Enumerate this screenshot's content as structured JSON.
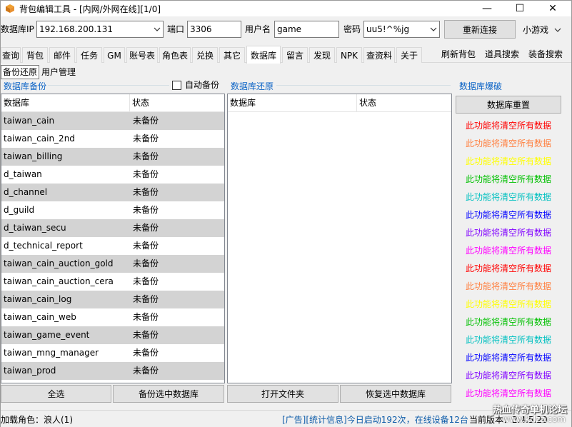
{
  "window": {
    "title": "背包编辑工具 - [内网/外网在线][1/0]",
    "minimize_glyph": "—",
    "maximize_glyph": "☐",
    "close_glyph": "✕"
  },
  "connection": {
    "db_ip_label": "数据库IP",
    "db_ip_value": "192.168.200.131",
    "port_label": "端口",
    "port_value": "3306",
    "user_label": "用户名",
    "user_value": "game",
    "password_label": "密码",
    "password_value": "uu5!^%jg",
    "reconnect_label": "重新连接",
    "minigame_label": "小游戏"
  },
  "tabs": [
    "查询",
    "背包",
    "邮件",
    "任务",
    "GM",
    "账号表",
    "角色表",
    "兑换",
    "其它",
    "数据库",
    "留言",
    "发现",
    "NPK",
    "查资料",
    "关于"
  ],
  "active_tab": "数据库",
  "toolbar": {
    "refresh_bag": "刷新背包",
    "item_search": "道具搜索",
    "equip_search": "装备搜索"
  },
  "subtabs": [
    "备份还原",
    "用户管理"
  ],
  "backup": {
    "section_title": "数据库备份",
    "auto_backup_label": "自动备份",
    "auto_backup_checked": false,
    "col_db": "数据库",
    "col_status": "状态",
    "rows": [
      {
        "db": "taiwan_cain",
        "status": "未备份"
      },
      {
        "db": "taiwan_cain_2nd",
        "status": "未备份"
      },
      {
        "db": "taiwan_billing",
        "status": "未备份"
      },
      {
        "db": "d_taiwan",
        "status": "未备份"
      },
      {
        "db": "d_channel",
        "status": "未备份"
      },
      {
        "db": "d_guild",
        "status": "未备份"
      },
      {
        "db": "d_taiwan_secu",
        "status": "未备份"
      },
      {
        "db": "d_technical_report",
        "status": "未备份"
      },
      {
        "db": "taiwan_cain_auction_gold",
        "status": "未备份"
      },
      {
        "db": "taiwan_cain_auction_cera",
        "status": "未备份"
      },
      {
        "db": "taiwan_cain_log",
        "status": "未备份"
      },
      {
        "db": "taiwan_cain_web",
        "status": "未备份"
      },
      {
        "db": "taiwan_game_event",
        "status": "未备份"
      },
      {
        "db": "taiwan_mng_manager",
        "status": "未备份"
      },
      {
        "db": "taiwan_prod",
        "status": "未备份"
      }
    ],
    "select_all_label": "全选",
    "backup_selected_label": "备份选中数据库"
  },
  "restore": {
    "section_title": "数据库还原",
    "col_db": "数据库",
    "col_status": "状态",
    "open_folder_label": "打开文件夹",
    "restore_selected_label": "恢复选中数据库"
  },
  "breach": {
    "section_title": "数据库爆破",
    "reset_label": "数据库重置",
    "warning_text": "此功能将清空所有数据",
    "warning_colors": [
      "#ff0000",
      "#ff8040",
      "#ffff00",
      "#00c000",
      "#00c0c0",
      "#0000ff",
      "#8000ff",
      "#ff00ff",
      "#ff0000",
      "#ff8040",
      "#ffff00",
      "#00c000",
      "#00c0c0",
      "#0000ff",
      "#8000ff",
      "#ff00ff"
    ]
  },
  "status": {
    "loaded_char": "加载角色：浪人(1)",
    "ad_text": "[广告][统计信息]今日启动192次，在线设备12台",
    "version_text": "当前版本：2.4.5.20",
    "watermark_top": "热血传奇单机论坛",
    "watermark_bottom": "www.kdzz.com"
  },
  "colors": {
    "accent_blue": "#0b63c6",
    "ad_text": "#0b5aa8"
  }
}
